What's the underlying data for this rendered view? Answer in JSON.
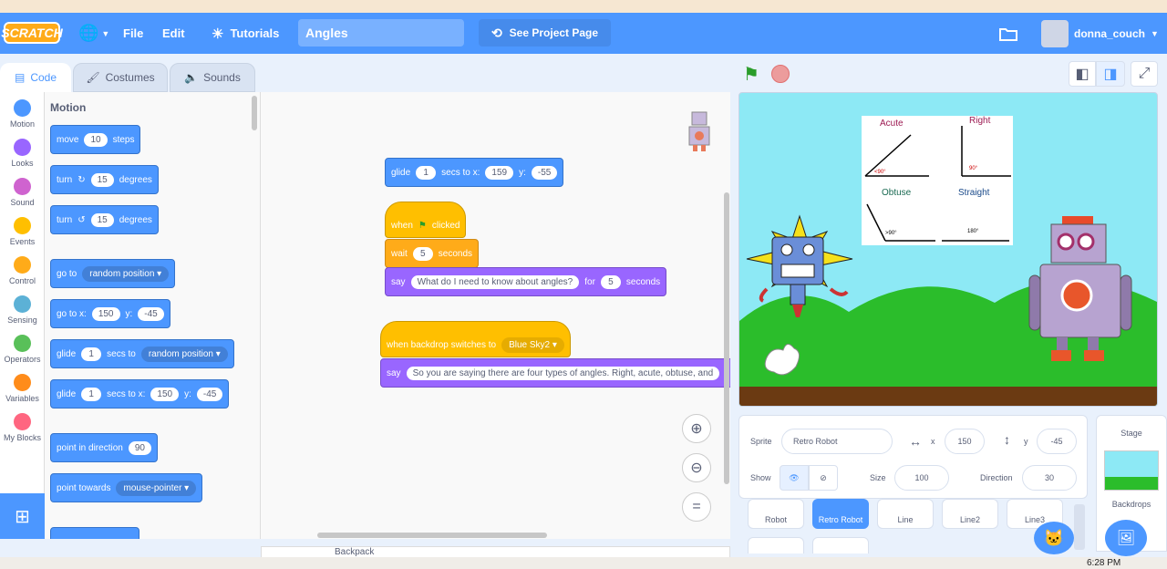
{
  "menubar": {
    "logo": "SCRATCH",
    "file": "File",
    "edit": "Edit",
    "tutorials": "Tutorials",
    "project_title": "Angles",
    "see_project_page": "See Project Page",
    "username": "donna_couch"
  },
  "tabs": {
    "code": "Code",
    "costumes": "Costumes",
    "sounds": "Sounds"
  },
  "categories": [
    {
      "label": "Motion",
      "color": "#4c97ff"
    },
    {
      "label": "Looks",
      "color": "#9966ff"
    },
    {
      "label": "Sound",
      "color": "#cf63cf"
    },
    {
      "label": "Events",
      "color": "#ffbf00"
    },
    {
      "label": "Control",
      "color": "#ffab19"
    },
    {
      "label": "Sensing",
      "color": "#5cb1d6"
    },
    {
      "label": "Operators",
      "color": "#59c059"
    },
    {
      "label": "Variables",
      "color": "#ff8c1a"
    },
    {
      "label": "My Blocks",
      "color": "#ff6680"
    }
  ],
  "palette": {
    "title": "Motion",
    "move": {
      "t1": "move",
      "v": "10",
      "t2": "steps"
    },
    "turn_right": {
      "t1": "turn",
      "v": "15",
      "t2": "degrees"
    },
    "turn_left": {
      "t1": "turn",
      "v": "15",
      "t2": "degrees"
    },
    "goto": {
      "t1": "go to",
      "dd": "random position ▾"
    },
    "gotoxy": {
      "t1": "go to x:",
      "x": "150",
      "t2": "y:",
      "y": "-45"
    },
    "glide_to": {
      "t1": "glide",
      "v": "1",
      "t2": "secs to",
      "dd": "random position ▾"
    },
    "glide_xy": {
      "t1": "glide",
      "v": "1",
      "t2": "secs to x:",
      "x": "150",
      "t3": "y:",
      "y": "-45"
    },
    "point_dir": {
      "t1": "point in direction",
      "v": "90"
    },
    "point_towards": {
      "t1": "point towards",
      "dd": "mouse-pointer ▾"
    }
  },
  "script": {
    "glide": {
      "t1": "glide",
      "v": "1",
      "t2": "secs to x:",
      "x": "159",
      "t3": "y:",
      "y": "-55"
    },
    "when_flag": {
      "t1": "when",
      "t2": "clicked"
    },
    "wait": {
      "t1": "wait",
      "v": "5",
      "t2": "seconds"
    },
    "say1": {
      "t1": "say",
      "msg": "What do I need to know about angles?",
      "t2": "for",
      "v": "5",
      "t3": "seconds"
    },
    "when_backdrop": {
      "t1": "when backdrop switches to",
      "dd": "Blue Sky2 ▾"
    },
    "say2": {
      "t1": "say",
      "msg": "So you are saying there are four types of angles.  Right, acute, obtuse, and"
    }
  },
  "stage": {
    "acute": "Acute",
    "right": "Right",
    "obtuse": "Obtuse",
    "straight": "Straight",
    "acute_deg": "<90°",
    "right_deg": "90°",
    "obtuse_deg": ">90°",
    "straight_deg": "180°"
  },
  "sprite_info": {
    "sprite_label": "Sprite",
    "sprite_name": "Retro Robot",
    "x_label": "x",
    "x": "150",
    "y_label": "y",
    "y": "-45",
    "show_label": "Show",
    "size_label": "Size",
    "size": "100",
    "direction_label": "Direction",
    "direction": "30"
  },
  "sprites": [
    "Robot",
    "Retro Robot",
    "Line",
    "Line2",
    "Line3"
  ],
  "stage_pane": {
    "title": "Stage",
    "backdrops": "Backdrops"
  },
  "backpack": "Backpack",
  "taskbar": {
    "time": "6:28 PM"
  }
}
